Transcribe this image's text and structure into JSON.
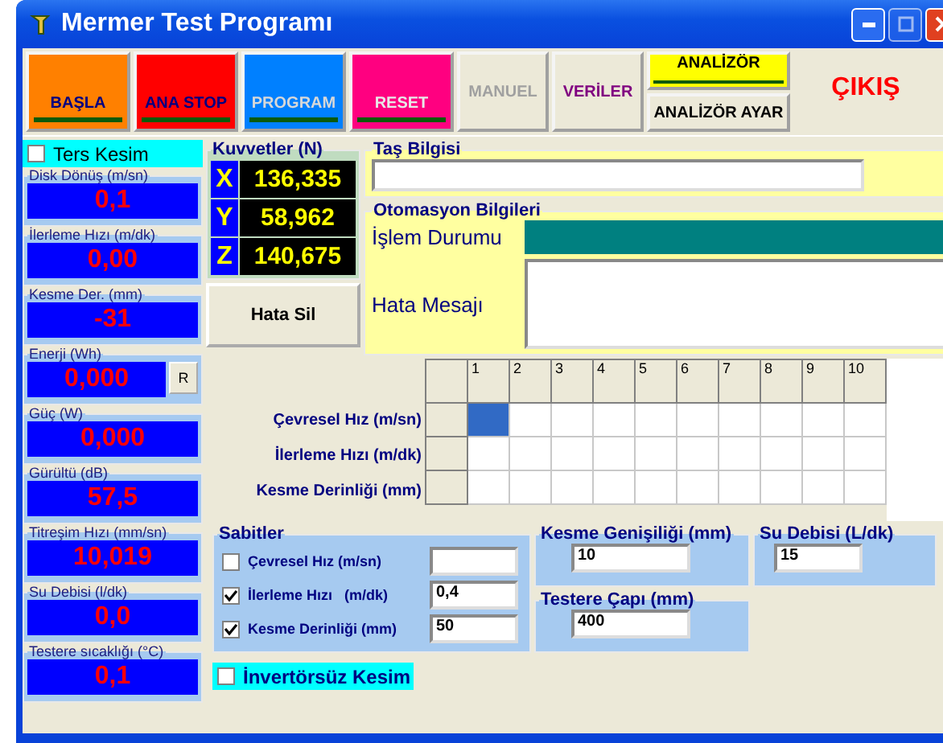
{
  "window": {
    "title": "Mermer Test Programı"
  },
  "toolbar": [
    {
      "kind": "colored",
      "label": "BAŞLA",
      "color": "#ff8000",
      "caption": {
        "color": "#000080"
      }
    },
    {
      "kind": "colored",
      "label": "ANA STOP",
      "color": "#ff0000",
      "caption": {
        "color": "#000080"
      }
    },
    {
      "kind": "colored",
      "label": "PROGRAM",
      "color": "#0080ff",
      "caption": {
        "color": "#d8d8d8"
      }
    },
    {
      "kind": "colored",
      "label": "RESET",
      "color": "#ff0080",
      "caption": {
        "color": "#e8e8e8"
      }
    },
    {
      "kind": "plain",
      "label": "MANUEL",
      "disabled": true
    },
    {
      "kind": "plain",
      "label": "VERİLER",
      "caption": {
        "color": "#800080"
      },
      "disabled": false
    },
    {
      "kind": "split",
      "label": "ANALİZÖR",
      "second_label": "ANALİZÖR AYAR",
      "color": "#ffff00",
      "caption": {
        "color": "#000000"
      }
    },
    {
      "kind": "exit",
      "label": "ÇIKIŞ",
      "caption": {
        "color": "#ff0000"
      }
    }
  ],
  "ters_kesim": {
    "label": "Ters Kesim",
    "checked": false
  },
  "readings": [
    {
      "label": "Disk Dönüş (m/sn)",
      "value": "0,1"
    },
    {
      "label": "İlerleme Hızı (m/dk)",
      "value": "0,00"
    },
    {
      "label": "Kesme Der. (mm)",
      "value": "-31"
    },
    {
      "label": "Enerji (Wh)",
      "value": "0,000",
      "button": "R"
    },
    {
      "label": "Güç (W)",
      "value": "0,000"
    },
    {
      "label": "Gürültü (dB)",
      "value": "57,5"
    },
    {
      "label": "Titreşim Hızı (mm/sn)",
      "value": "10,019"
    },
    {
      "label": "Su Debisi (l/dk)",
      "value": "0,0"
    },
    {
      "label": "Testere sıcaklığı (°C)",
      "value": "0,1"
    }
  ],
  "forces": {
    "title": "Kuvvetler (N)",
    "rows": [
      {
        "axis": "X",
        "value": "136,335"
      },
      {
        "axis": "Y",
        "value": "58,962"
      },
      {
        "axis": "Z",
        "value": "140,675"
      }
    ]
  },
  "clear_error_button": "Hata Sil",
  "stone_info": {
    "title": "Taş Bilgisi"
  },
  "automation": {
    "title": "Otomasyon Bilgileri",
    "status_label": "İşlem Durumu",
    "error_label": "Hata Mesajı"
  },
  "grid": {
    "columns": [
      "1",
      "2",
      "3",
      "4",
      "5",
      "6",
      "7",
      "8",
      "9",
      "10"
    ],
    "rows": [
      {
        "label": "Çevresel Hız (m/sn)",
        "cells": [
          {
            "selected": true
          },
          {
            "selected": false
          },
          {
            "selected": false
          },
          {
            "selected": false
          },
          {
            "selected": false
          },
          {
            "selected": false
          },
          {
            "selected": false
          },
          {
            "selected": false
          },
          {
            "selected": false
          },
          {
            "selected": false
          }
        ]
      },
      {
        "label": "İlerleme Hızı (m/dk)",
        "cells": [
          {
            "selected": false
          },
          {
            "selected": false
          },
          {
            "selected": false
          },
          {
            "selected": false
          },
          {
            "selected": false
          },
          {
            "selected": false
          },
          {
            "selected": false
          },
          {
            "selected": false
          },
          {
            "selected": false
          },
          {
            "selected": false
          }
        ]
      },
      {
        "label": "Kesme Derinliği (mm)",
        "cells": [
          {
            "selected": false
          },
          {
            "selected": false
          },
          {
            "selected": false
          },
          {
            "selected": false
          },
          {
            "selected": false
          },
          {
            "selected": false
          },
          {
            "selected": false
          },
          {
            "selected": false
          },
          {
            "selected": false
          },
          {
            "selected": false
          }
        ]
      }
    ]
  },
  "constants": {
    "title": "Sabitler",
    "items": [
      {
        "label": "Çevresel Hız (m/sn)",
        "checked": false
      },
      {
        "label": "İlerleme Hızı   (m/dk)",
        "checked": true,
        "value": "0,4"
      },
      {
        "label": "Kesme Derinliği (mm)",
        "checked": true,
        "value": "50"
      }
    ]
  },
  "cut_width": {
    "title": "Kesme Genişiliği (mm)",
    "value": "10"
  },
  "water_flow": {
    "title": "Su Debisi (L/dk)",
    "value": "15"
  },
  "saw_diameter": {
    "title": "Testere Çapı (mm)",
    "value": "400"
  },
  "invertersiz": {
    "label": "İnvertörsüz Kesim",
    "checked": false
  }
}
